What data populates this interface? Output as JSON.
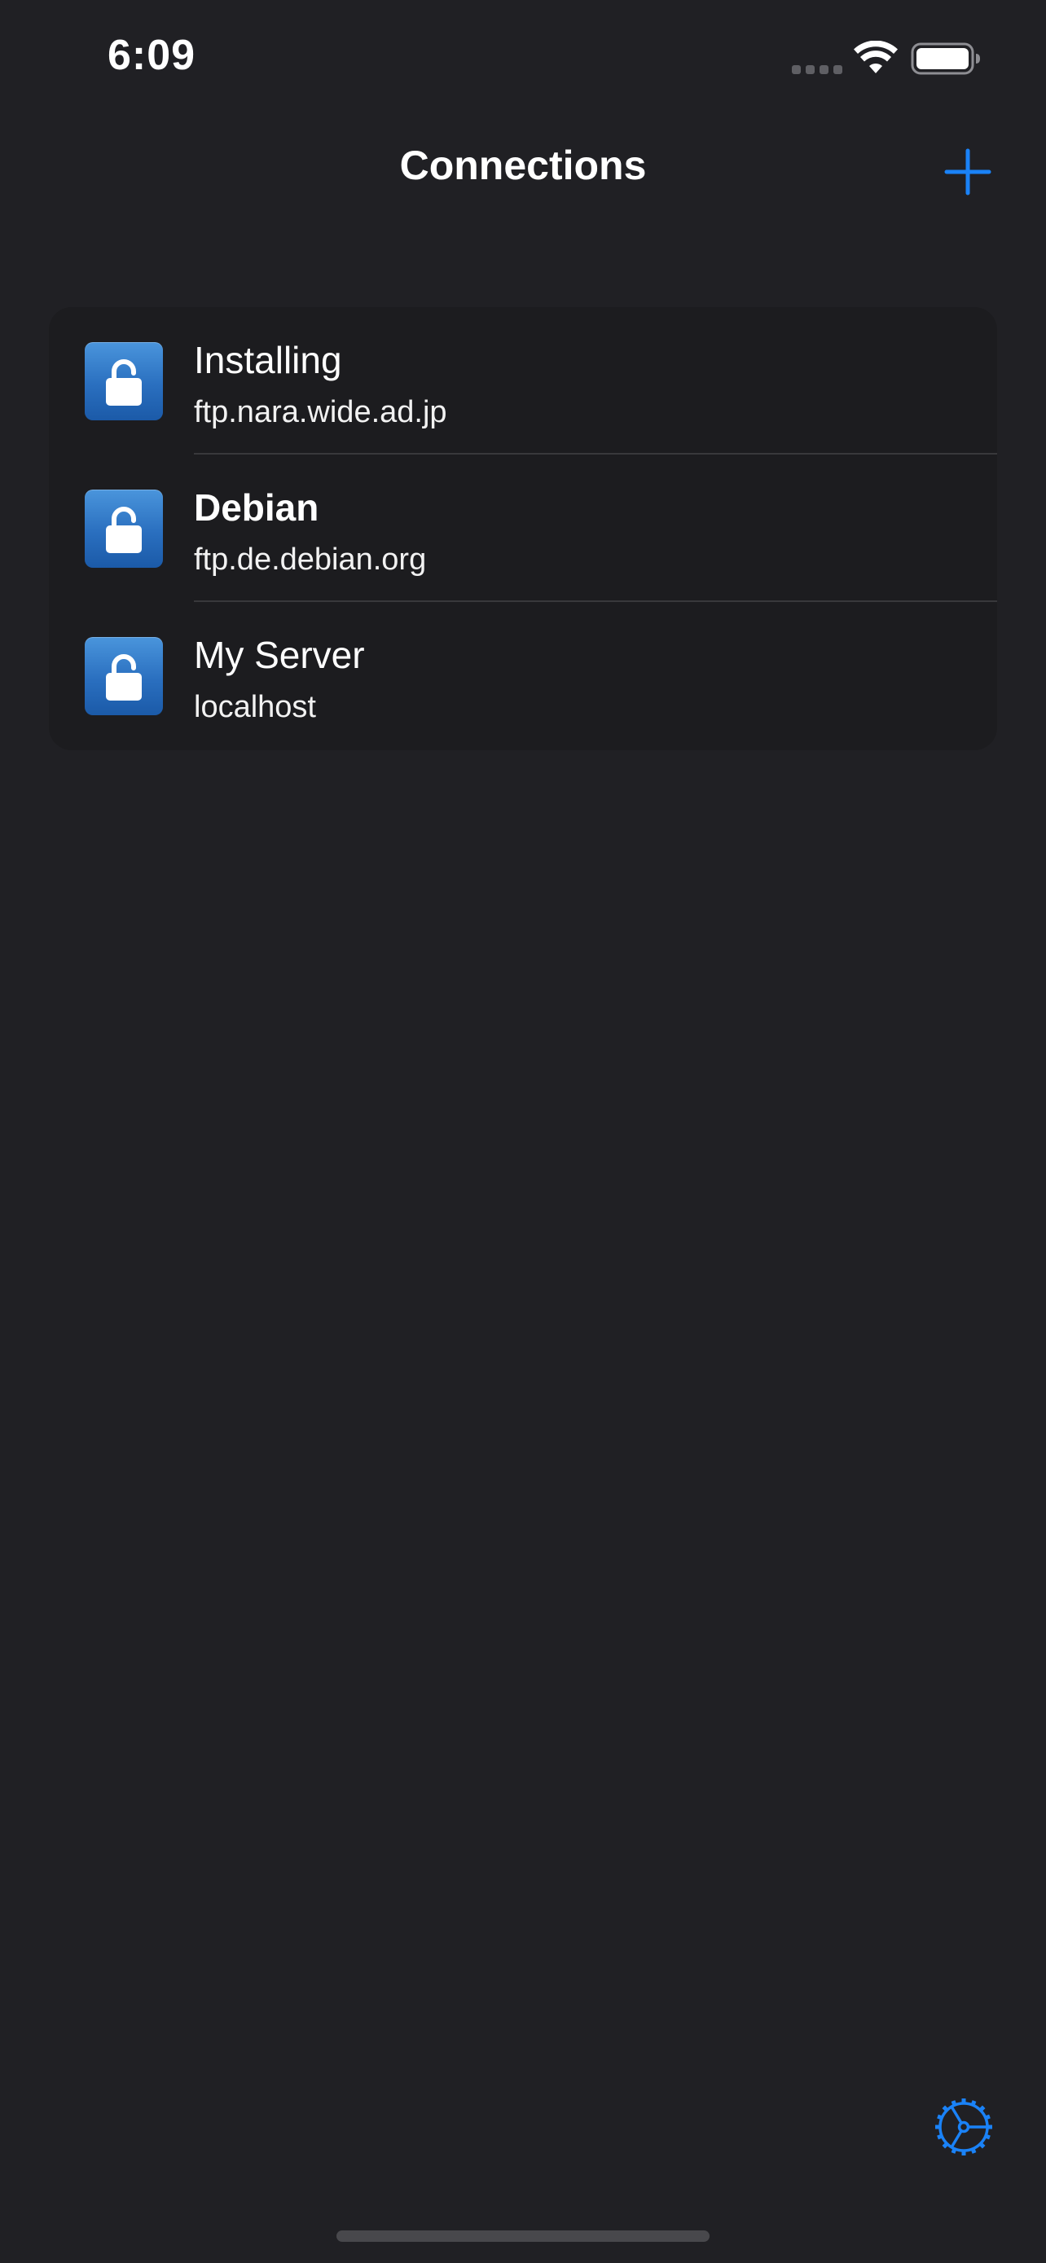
{
  "status_bar": {
    "time": "6:09"
  },
  "nav": {
    "title": "Connections",
    "add_icon": "plus-icon"
  },
  "connections": [
    {
      "title": "Installing",
      "host": "ftp.nara.wide.ad.jp",
      "icon": "unlocked-lock-icon",
      "bold": false
    },
    {
      "title": "Debian",
      "host": "ftp.de.debian.org",
      "icon": "unlocked-lock-icon",
      "bold": true
    },
    {
      "title": "My Server",
      "host": "localhost",
      "icon": "unlocked-lock-icon",
      "bold": false
    }
  ],
  "toolbar": {
    "settings_icon": "gear-icon"
  },
  "colors": {
    "background": "#202024",
    "card": "#1c1c1f",
    "accent": "#1a82f7",
    "icon_blue": "#2a6fbf"
  }
}
